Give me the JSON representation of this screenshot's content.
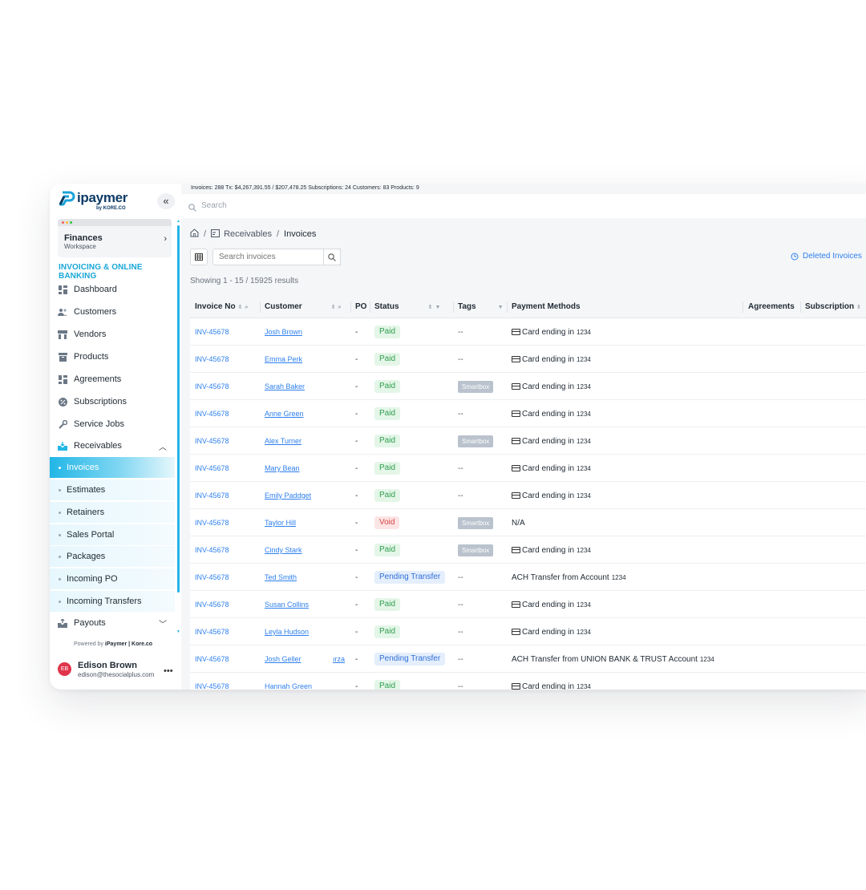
{
  "app": {
    "logo_text": "ipaymer",
    "logo_sub": "by KORE.CO",
    "stats_text": "Invoices: 288   Tx: $4,267,391.55 / $207,478.25   Subscriptions: 24   Customers: 83   Products: 9",
    "top_search_placeholder": "Search"
  },
  "sidebar": {
    "collapse_icon": "«",
    "workspace": {
      "name": "Finances",
      "sub": "Workspace"
    },
    "section_title": "INVOICING & ONLINE BANKING",
    "items": [
      {
        "label": "Dashboard",
        "icon": "dashboard-icon"
      },
      {
        "label": "Customers",
        "icon": "users-icon"
      },
      {
        "label": "Vendors",
        "icon": "store-icon"
      },
      {
        "label": "Products",
        "icon": "box-icon"
      },
      {
        "label": "Agreements",
        "icon": "grid-icon"
      },
      {
        "label": "Subscriptions",
        "icon": "percent-icon"
      },
      {
        "label": "Service Jobs",
        "icon": "wrench-icon"
      },
      {
        "label": "Receivables",
        "icon": "inbox-icon",
        "expanded": true
      }
    ],
    "sub_items": [
      {
        "label": "Invoices",
        "active": true
      },
      {
        "label": "Estimates"
      },
      {
        "label": "Retainers"
      },
      {
        "label": "Sales Portal"
      },
      {
        "label": "Packages"
      },
      {
        "label": "Incoming PO"
      },
      {
        "label": "Incoming Transfers"
      }
    ],
    "payouts": {
      "label": "Payouts",
      "icon": "outbox-icon"
    },
    "powered_prefix": "Powered by",
    "powered_brand": "iPaymer | Kore.co",
    "user": {
      "initials": "EB",
      "name": "Edison Brown",
      "email": "edison@thesocialplus.com"
    }
  },
  "main": {
    "breadcrumb": {
      "parent": "Receivables",
      "current": "Invoices"
    },
    "search_placeholder": "Search invoices",
    "deleted_label": "Deleted Invoices",
    "showing_text": "Showing 1 - 15 / 15925 results",
    "columns": {
      "invoice_no": "Invoice No",
      "customer": "Customer",
      "po": "PO",
      "status": "Status",
      "tags": "Tags",
      "payment_methods": "Payment Methods",
      "agreements": "Agreements",
      "subscription": "Subscription"
    },
    "rows": [
      {
        "inv": "INV-45678",
        "customer": "Josh Brown",
        "po": "-",
        "status": "Paid",
        "tag": "--",
        "pay_type": "card",
        "pay_text": "Card ending in",
        "pay_num": "1234"
      },
      {
        "inv": "INV-45678",
        "customer": "Emma Perk",
        "po": "-",
        "status": "Paid",
        "tag": "--",
        "pay_type": "card",
        "pay_text": "Card ending in",
        "pay_num": "1234"
      },
      {
        "inv": "INV-45678",
        "customer": "Sarah Baker",
        "po": "-",
        "status": "Paid",
        "tag": "Smartbox",
        "pay_type": "card",
        "pay_text": "Card ending in",
        "pay_num": "1234"
      },
      {
        "inv": "INV-45678",
        "customer": "Anne Green",
        "po": "-",
        "status": "Paid",
        "tag": "--",
        "pay_type": "card",
        "pay_text": "Card ending in",
        "pay_num": "1234"
      },
      {
        "inv": "INV-45678",
        "customer": "Alex Turner",
        "po": "-",
        "status": "Paid",
        "tag": "Smartbox",
        "pay_type": "card",
        "pay_text": "Card ending in",
        "pay_num": "1234"
      },
      {
        "inv": "INV-45678",
        "customer": "Mary Bean",
        "po": "-",
        "status": "Paid",
        "tag": "--",
        "pay_type": "card",
        "pay_text": "Card ending in",
        "pay_num": "1234"
      },
      {
        "inv": "INV-45678",
        "customer": "Emily Paddget",
        "po": "-",
        "status": "Paid",
        "tag": "--",
        "pay_type": "card",
        "pay_text": "Card ending in",
        "pay_num": "1234"
      },
      {
        "inv": "INV-45678",
        "customer": "Taylor Hill",
        "po": "-",
        "status": "Void",
        "tag": "Smartbox",
        "pay_type": "none",
        "pay_text": "N/A",
        "pay_num": ""
      },
      {
        "inv": "INV-45678",
        "customer": "Cindy Stark",
        "po": "-",
        "status": "Paid",
        "tag": "Smartbox",
        "pay_type": "card",
        "pay_text": "Card ending in",
        "pay_num": "1234"
      },
      {
        "inv": "INV-45678",
        "customer": "Ted Smith",
        "po": "-",
        "status": "Pending Transfer",
        "tag": "--",
        "pay_type": "ach",
        "pay_text": "ACH Transfer from Account",
        "pay_num": "1234"
      },
      {
        "inv": "INV-45678",
        "customer": "Susan Collins",
        "po": "-",
        "status": "Paid",
        "tag": "--",
        "pay_type": "card",
        "pay_text": "Card ending in",
        "pay_num": "1234"
      },
      {
        "inv": "INV-45678",
        "customer": "Leyla Hudson",
        "po": "-",
        "status": "Paid",
        "tag": "--",
        "pay_type": "card",
        "pay_text": "Card ending in",
        "pay_num": "1234"
      },
      {
        "inv": "INV-45678",
        "customer": "Josh Geller",
        "po": "-",
        "po_extra": "ırza",
        "status": "Pending Transfer",
        "tag": "--",
        "pay_type": "ach",
        "pay_text": "ACH Transfer from UNION BANK & TRUST Account",
        "pay_num": "1234"
      },
      {
        "inv": "INV-45678",
        "customer": "Hannah Green",
        "po": "-",
        "status": "Paid",
        "tag": "--",
        "pay_type": "card",
        "pay_text": "Card ending in",
        "pay_num": "1234"
      }
    ]
  },
  "colors": {
    "accent": "#22b6e6",
    "link": "#2f80ed",
    "paid": "#2e9e4d",
    "void": "#d64545",
    "pending": "#2f6fd6",
    "avatar": "#e0344b"
  }
}
